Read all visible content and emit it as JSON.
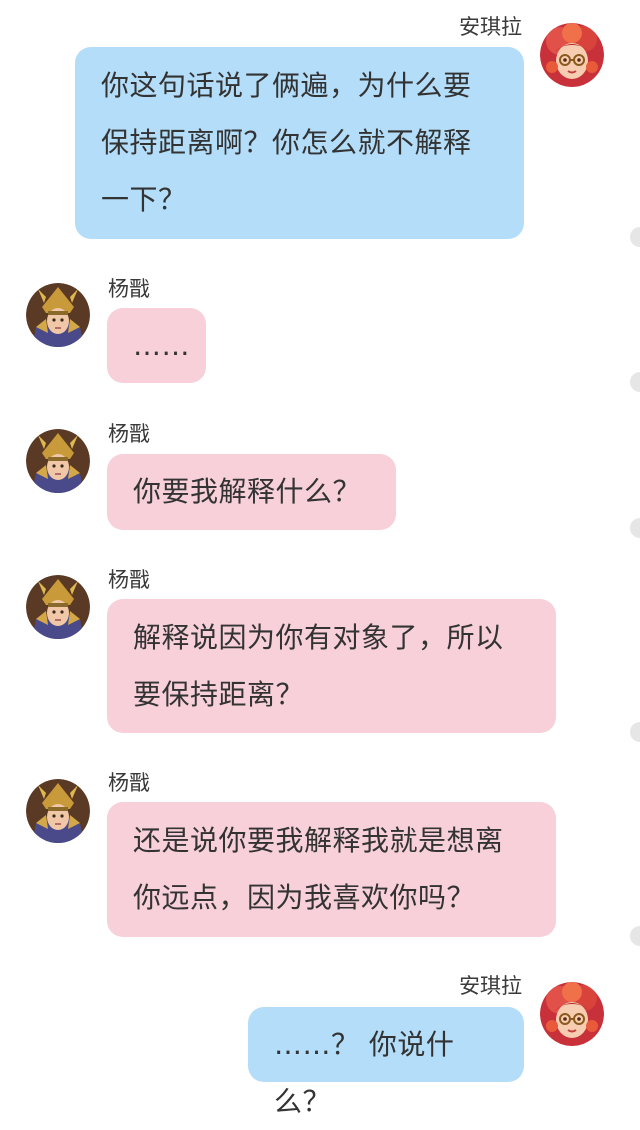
{
  "colors": {
    "outgoing_bubble": "#b3ddf8",
    "incoming_bubble": "#f7d0da",
    "text": "#333333",
    "scroll_dot": "#e6e6e6"
  },
  "messages": [
    {
      "sender": "安琪拉",
      "side": "right",
      "avatar_icon": "red-haired-girl-avatar-icon",
      "lines": [
        "你这句话说了俩遍，为什么要",
        "保持距离啊？你怎么就不解释",
        "一下？"
      ]
    },
    {
      "sender": "杨戬",
      "side": "left",
      "avatar_icon": "armored-warrior-avatar-icon",
      "lines": [
        "……"
      ]
    },
    {
      "sender": "杨戬",
      "side": "left",
      "avatar_icon": "armored-warrior-avatar-icon",
      "lines": [
        "你要我解释什么？"
      ]
    },
    {
      "sender": "杨戬",
      "side": "left",
      "avatar_icon": "armored-warrior-avatar-icon",
      "lines": [
        "解释说因为你有对象了，所以",
        "要保持距离？"
      ]
    },
    {
      "sender": "杨戬",
      "side": "left",
      "avatar_icon": "armored-warrior-avatar-icon",
      "lines": [
        "还是说你要我解释我就是想离",
        "你远点，因为我喜欢你吗？"
      ]
    },
    {
      "sender": "安琪拉",
      "side": "right",
      "avatar_icon": "red-haired-girl-avatar-icon",
      "lines": [
        "……？ 你说什么？"
      ]
    }
  ]
}
